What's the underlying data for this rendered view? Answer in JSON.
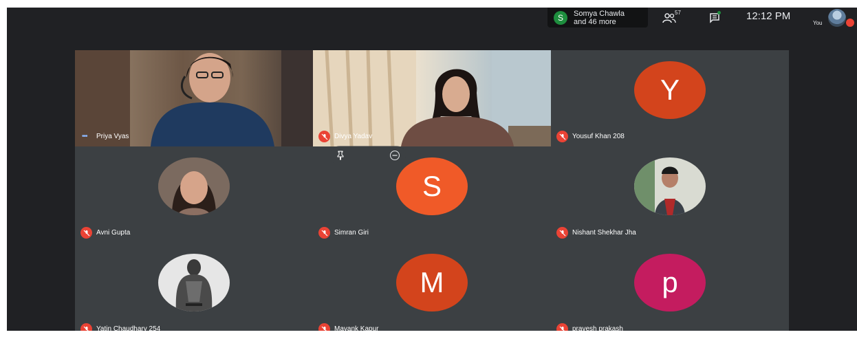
{
  "topbar": {
    "chip": {
      "avatar_letter": "S",
      "line1": "Somya Chawla",
      "line2": "and 46 more"
    },
    "people_count": "57",
    "clock": "12:12 PM",
    "self_label": "You"
  },
  "colors": {
    "meet_bg": "#202124",
    "tile_bg": "#3c4043",
    "mute_red": "#ea4335",
    "avatar_orange": "#d3441c",
    "avatar_pink": "#c41c5f"
  },
  "tiles": [
    {
      "name": "Priya Vyas",
      "type": "video",
      "mic": "speaking"
    },
    {
      "name": "Divya Yadav",
      "type": "video",
      "mic": "muted"
    },
    {
      "name": "Yousuf Khan 208",
      "type": "letter",
      "letter": "Y",
      "color": "#d3441c",
      "mic": "muted"
    },
    {
      "name": "Avni Gupta",
      "type": "photo",
      "mic": "muted"
    },
    {
      "name": "Simran Giri",
      "type": "letter",
      "letter": "S",
      "color": "#f05a28",
      "mic": "muted"
    },
    {
      "name": "Nishant Shekhar Jha",
      "type": "photo",
      "mic": "muted"
    },
    {
      "name": "Yatin Chaudhary 254",
      "type": "photo",
      "mic": "muted"
    },
    {
      "name": "Mayank Kapur",
      "type": "letter",
      "letter": "M",
      "color": "#d3441c",
      "mic": "muted"
    },
    {
      "name": "pravesh prakash",
      "type": "letter",
      "letter": "p",
      "color": "#c41c5f",
      "mic": "muted"
    }
  ]
}
